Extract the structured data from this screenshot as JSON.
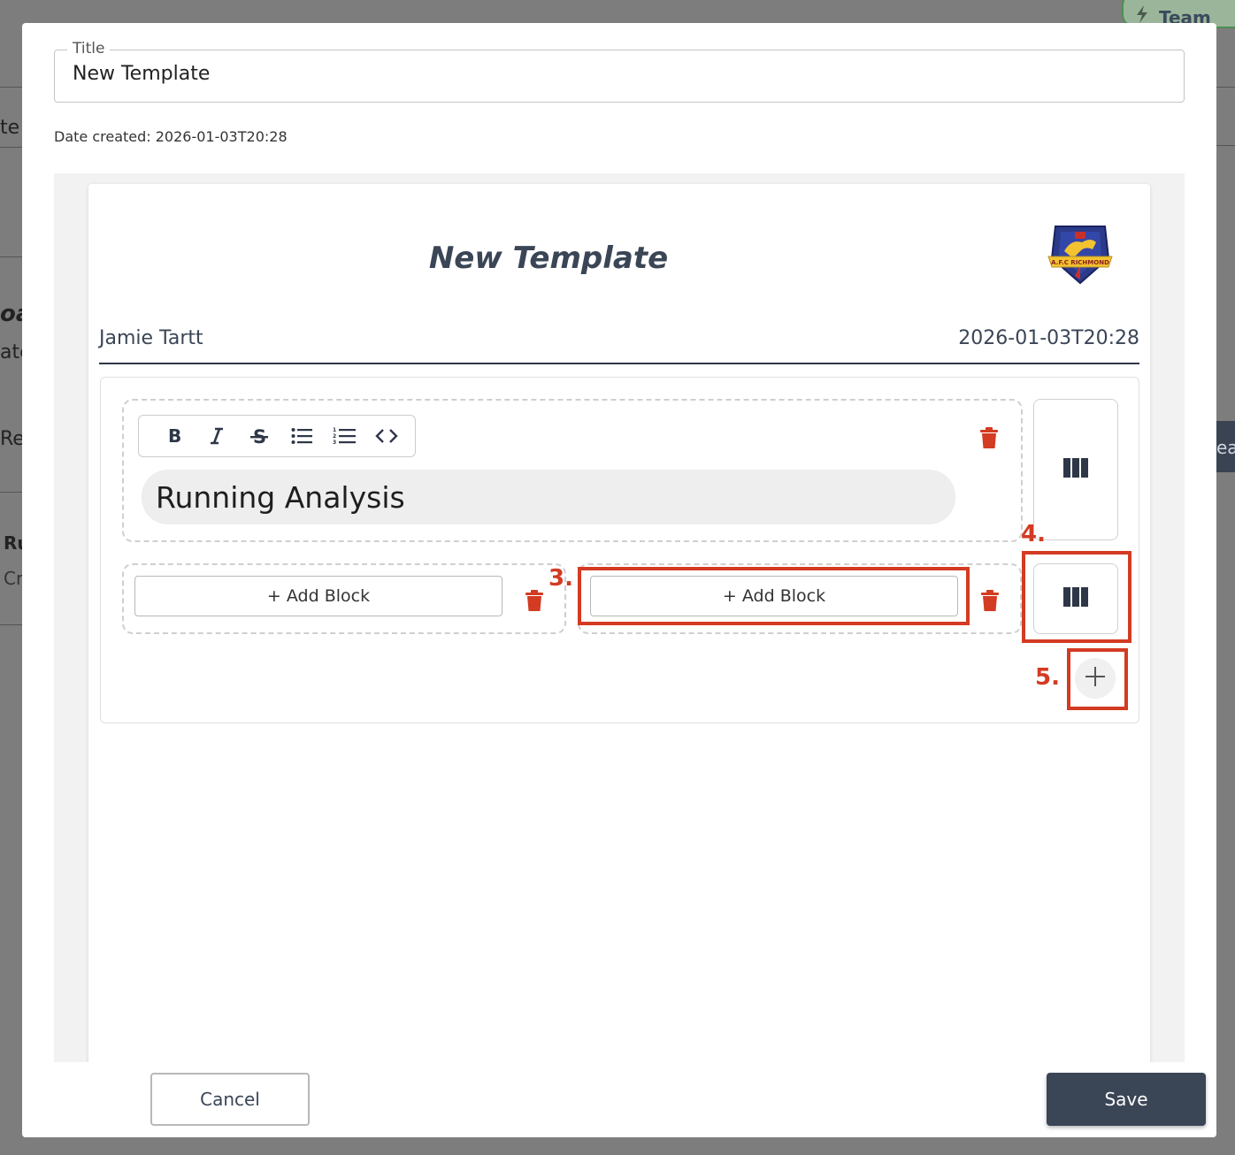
{
  "backdrop": {
    "team_label": "Team",
    "fragments": [
      "te",
      "oa",
      "ate",
      "Re",
      "Ru",
      "Cr"
    ],
    "right_tab_text": "ea"
  },
  "modal": {
    "title_legend": "Title",
    "title_value": "New Template",
    "date_created": "Date created: 2026-01-03T20:28"
  },
  "template": {
    "heading": "New Template",
    "author": "Jamie Tartt",
    "date": "2026-01-03T20:28",
    "logo": "afc-richmond-crest",
    "rows": [
      {
        "blocks": [
          {
            "type": "text",
            "toolbar": [
              "bold-icon",
              "italic-icon",
              "strikethrough-icon",
              "bullet-list-icon",
              "numbered-list-icon",
              "code-icon"
            ],
            "content": "Running Analysis"
          }
        ],
        "layout_icon": "columns-icon"
      },
      {
        "blocks": [
          {
            "type": "empty",
            "label": "+ Add Block"
          },
          {
            "type": "empty",
            "label": "+ Add Block"
          }
        ],
        "layout_icon": "columns-icon"
      }
    ],
    "add_row_icon": "plus-icon"
  },
  "annotations": [
    "3.",
    "4.",
    "5."
  ],
  "annotation_color": "#d33b22",
  "footer": {
    "cancel_label": "Cancel",
    "save_label": "Save"
  },
  "colors": {
    "primary": "#3a4556",
    "danger": "#d33b22"
  }
}
